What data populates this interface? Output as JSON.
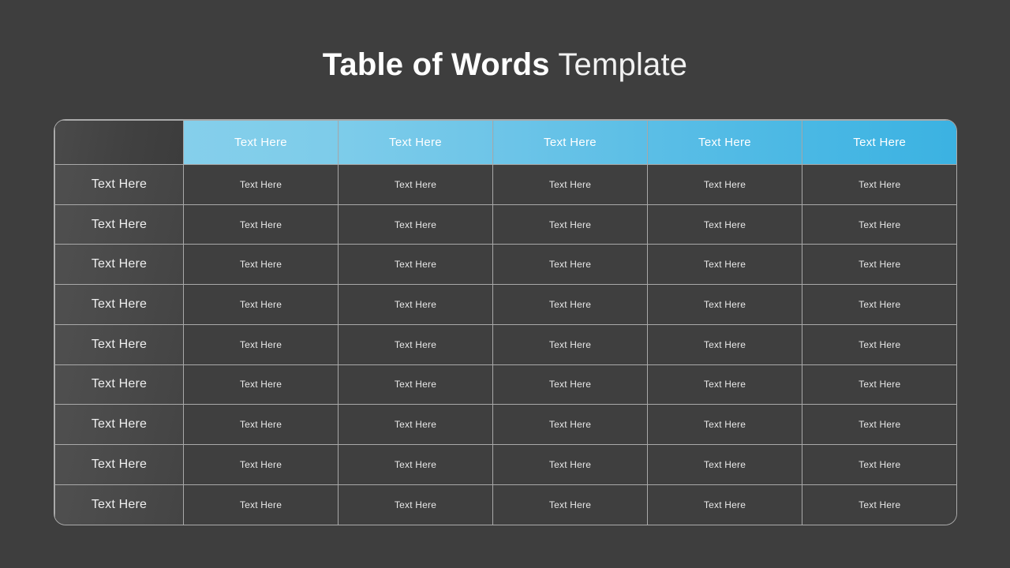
{
  "title": {
    "strong": "Table of Words",
    "light": " Template"
  },
  "colors": {
    "page_background": "#3e3e3e",
    "header_blue_start": "#85cfeb",
    "header_blue_end": "#3bb2e2",
    "grid_line": "#a9a9a9",
    "label_column_background": "#4a4a4a",
    "data_cell_background": "#3f3f3f",
    "text_primary": "#ffffff"
  },
  "table": {
    "corner_label": "",
    "header": [
      "Text Here",
      "Text Here",
      "Text Here",
      "Text Here",
      "Text Here"
    ],
    "rows": [
      {
        "label": "Text Here",
        "cells": [
          "Text Here",
          "Text Here",
          "Text Here",
          "Text Here",
          "Text Here"
        ]
      },
      {
        "label": "Text Here",
        "cells": [
          "Text Here",
          "Text Here",
          "Text Here",
          "Text Here",
          "Text Here"
        ]
      },
      {
        "label": "Text Here",
        "cells": [
          "Text Here",
          "Text Here",
          "Text Here",
          "Text Here",
          "Text Here"
        ]
      },
      {
        "label": "Text Here",
        "cells": [
          "Text Here",
          "Text Here",
          "Text Here",
          "Text Here",
          "Text Here"
        ]
      },
      {
        "label": "Text Here",
        "cells": [
          "Text Here",
          "Text Here",
          "Text Here",
          "Text Here",
          "Text Here"
        ]
      },
      {
        "label": "Text Here",
        "cells": [
          "Text Here",
          "Text Here",
          "Text Here",
          "Text Here",
          "Text Here"
        ]
      },
      {
        "label": "Text Here",
        "cells": [
          "Text Here",
          "Text Here",
          "Text Here",
          "Text Here",
          "Text Here"
        ]
      },
      {
        "label": "Text Here",
        "cells": [
          "Text Here",
          "Text Here",
          "Text Here",
          "Text Here",
          "Text Here"
        ]
      },
      {
        "label": "Text Here",
        "cells": [
          "Text Here",
          "Text Here",
          "Text Here",
          "Text Here",
          "Text Here"
        ]
      }
    ]
  }
}
